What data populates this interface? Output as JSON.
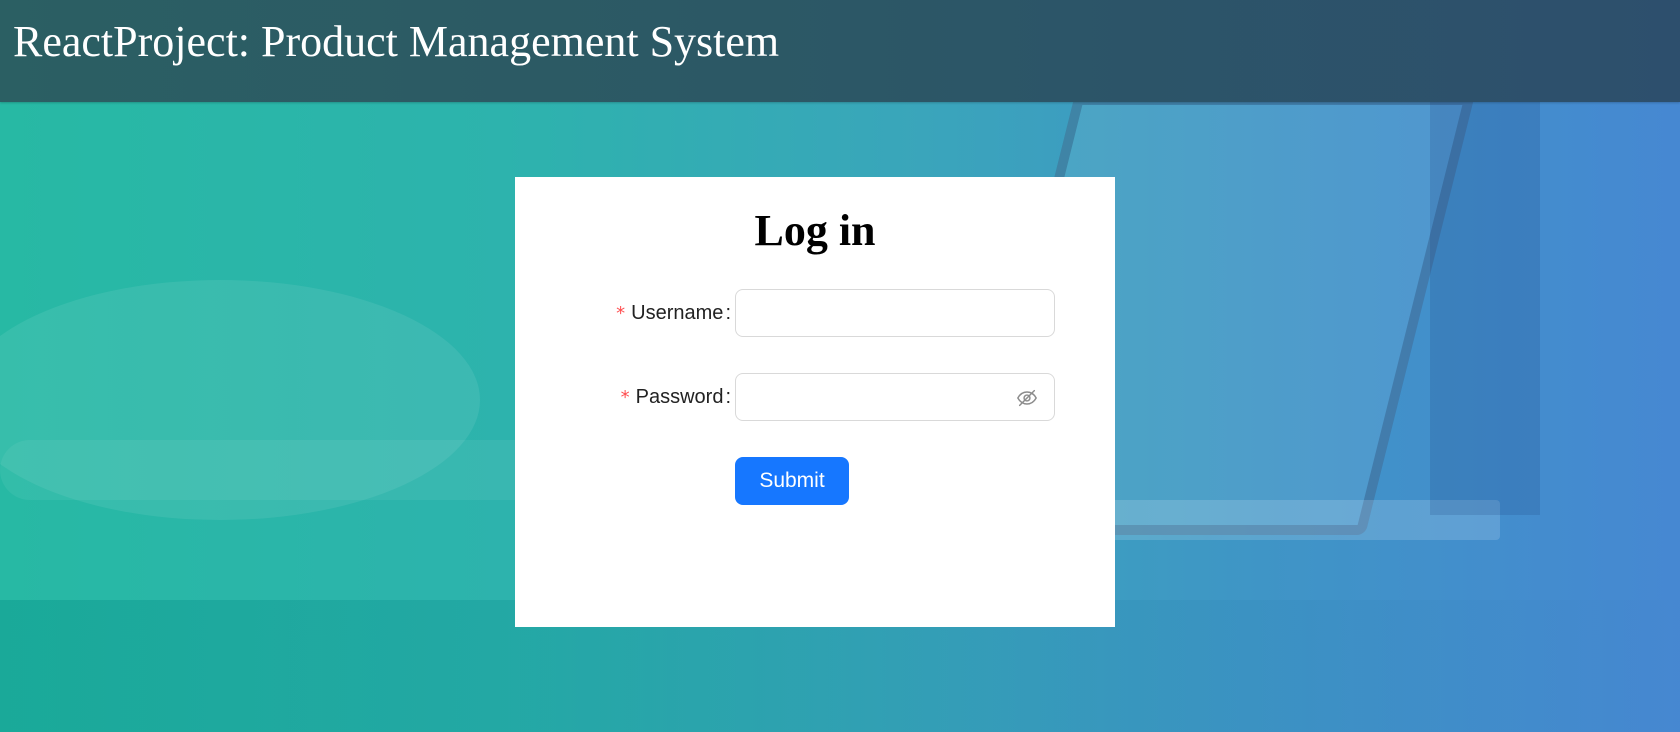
{
  "header": {
    "title": "ReactProject: Product Management System"
  },
  "login": {
    "heading": "Log in",
    "required_mark": "*",
    "username": {
      "label": "Username",
      "colon": ":",
      "value": "",
      "placeholder": ""
    },
    "password": {
      "label": "Password",
      "colon": ":",
      "value": "",
      "placeholder": "",
      "toggle_icon": "eye-invisible-icon"
    },
    "submit_label": "Submit"
  },
  "colors": {
    "primary": "#1677ff",
    "required": "#ff4d4f",
    "header_bg": "#2c5865",
    "background_start": "#27b9a4",
    "background_end": "#4688d2"
  }
}
